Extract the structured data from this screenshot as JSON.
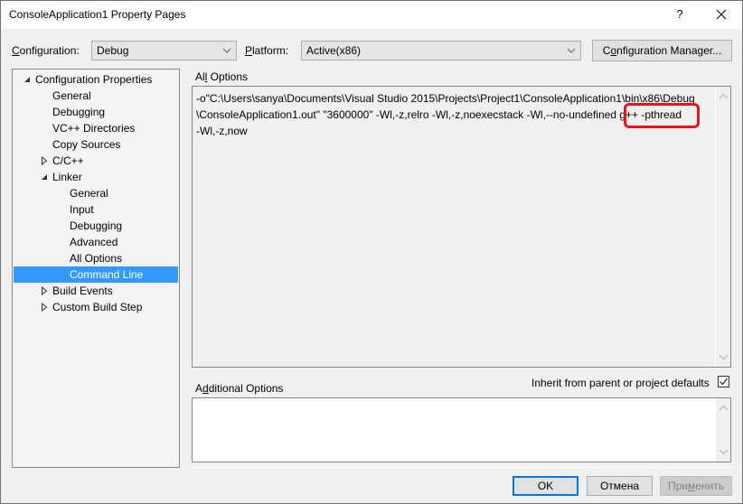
{
  "window": {
    "title": "ConsoleApplication1 Property Pages",
    "help_label": "?",
    "close_label": "✕"
  },
  "toolbar": {
    "configuration_label_pre": "",
    "configuration_label_accel": "C",
    "configuration_label_post": "onfiguration:",
    "configuration_value": "Debug",
    "platform_label_accel": "P",
    "platform_label_post": "latform:",
    "platform_value": "Active(x86)",
    "config_manager_pre": "C",
    "config_manager_accel": "o",
    "config_manager_post": "nfiguration Manager..."
  },
  "tree": {
    "items": [
      {
        "label": "Configuration Properties",
        "level": 0,
        "expander": "expanded"
      },
      {
        "label": "General",
        "level": 1,
        "expander": "none"
      },
      {
        "label": "Debugging",
        "level": 1,
        "expander": "none"
      },
      {
        "label": "VC++ Directories",
        "level": 1,
        "expander": "none"
      },
      {
        "label": "Copy Sources",
        "level": 1,
        "expander": "none"
      },
      {
        "label": "C/C++",
        "level": 1,
        "expander": "collapsed"
      },
      {
        "label": "Linker",
        "level": 1,
        "expander": "expanded"
      },
      {
        "label": "General",
        "level": 2,
        "expander": "none"
      },
      {
        "label": "Input",
        "level": 2,
        "expander": "none"
      },
      {
        "label": "Debugging",
        "level": 2,
        "expander": "none"
      },
      {
        "label": "Advanced",
        "level": 2,
        "expander": "none"
      },
      {
        "label": "All Options",
        "level": 2,
        "expander": "none"
      },
      {
        "label": "Command Line",
        "level": 2,
        "expander": "none",
        "selected": true
      },
      {
        "label": "Build Events",
        "level": 1,
        "expander": "collapsed"
      },
      {
        "label": "Custom Build Step",
        "level": 1,
        "expander": "collapsed"
      }
    ]
  },
  "all_options": {
    "label_pre": "Al",
    "label_accel": "l",
    "label_post": " Options",
    "line1": "-o\"C:\\Users\\sanya\\Documents\\Visual Studio 2015\\Projects\\Project1\\ConsoleApplication1\\bin\\x86\\Debug",
    "line2": "\\ConsoleApplication1.out\" \"3600000\" -Wl,-z,relro -Wl,-z,noexecstack -Wl,--no-undefined  g++ -pthread",
    "line3": "-Wl,-z,now",
    "highlight_text": "g++ -pthread",
    "highlight_color": "#e8141c"
  },
  "additional_options": {
    "label_pre": "A",
    "label_accel": "d",
    "label_post": "ditional Options",
    "value": "",
    "inherit_label": "Inherit from parent or project defaults",
    "inherit_checked": true
  },
  "footer": {
    "ok_label": "OK",
    "cancel_label": "Отмена",
    "apply_pre": "При",
    "apply_accel": "м",
    "apply_post": "енить",
    "apply_enabled": false
  },
  "colors": {
    "selection": "#3399ff",
    "default_button_border": "#0078d7"
  }
}
